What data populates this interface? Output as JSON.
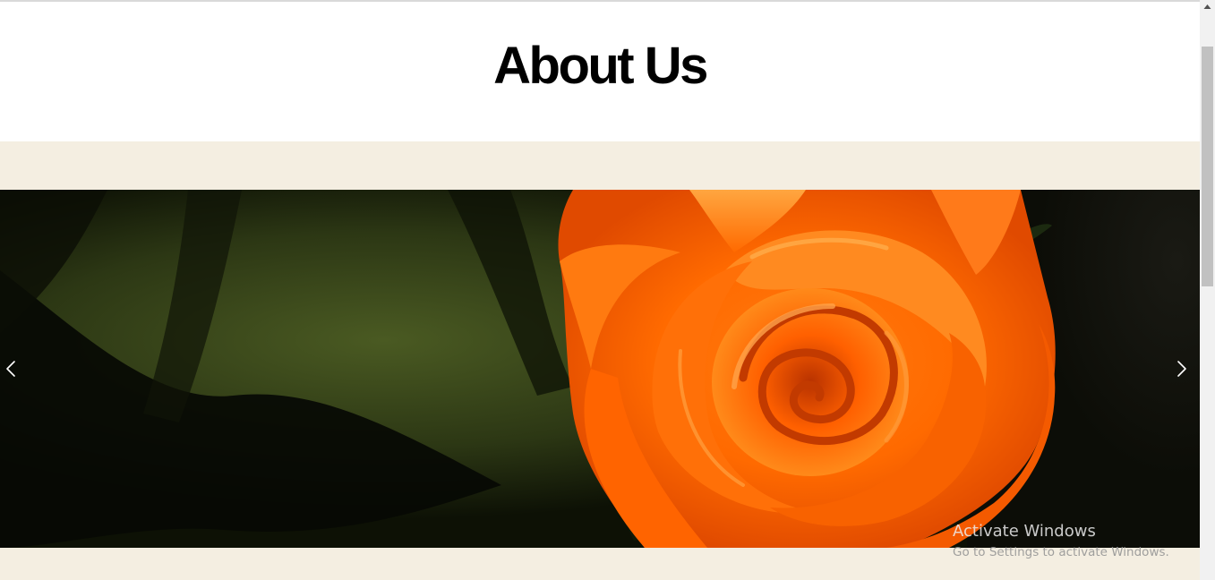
{
  "header": {
    "title": "About Us"
  },
  "slider": {
    "image_subject": "orange rose on dark green background",
    "prev_icon": "chevron-left-icon",
    "next_icon": "chevron-right-icon"
  },
  "watermark": {
    "title": "Activate Windows",
    "subtitle": "Go to Settings to activate Windows."
  },
  "colors": {
    "band_background": "#f4eee1",
    "title_text": "#000000",
    "rose_orange": "#ff6a00"
  }
}
